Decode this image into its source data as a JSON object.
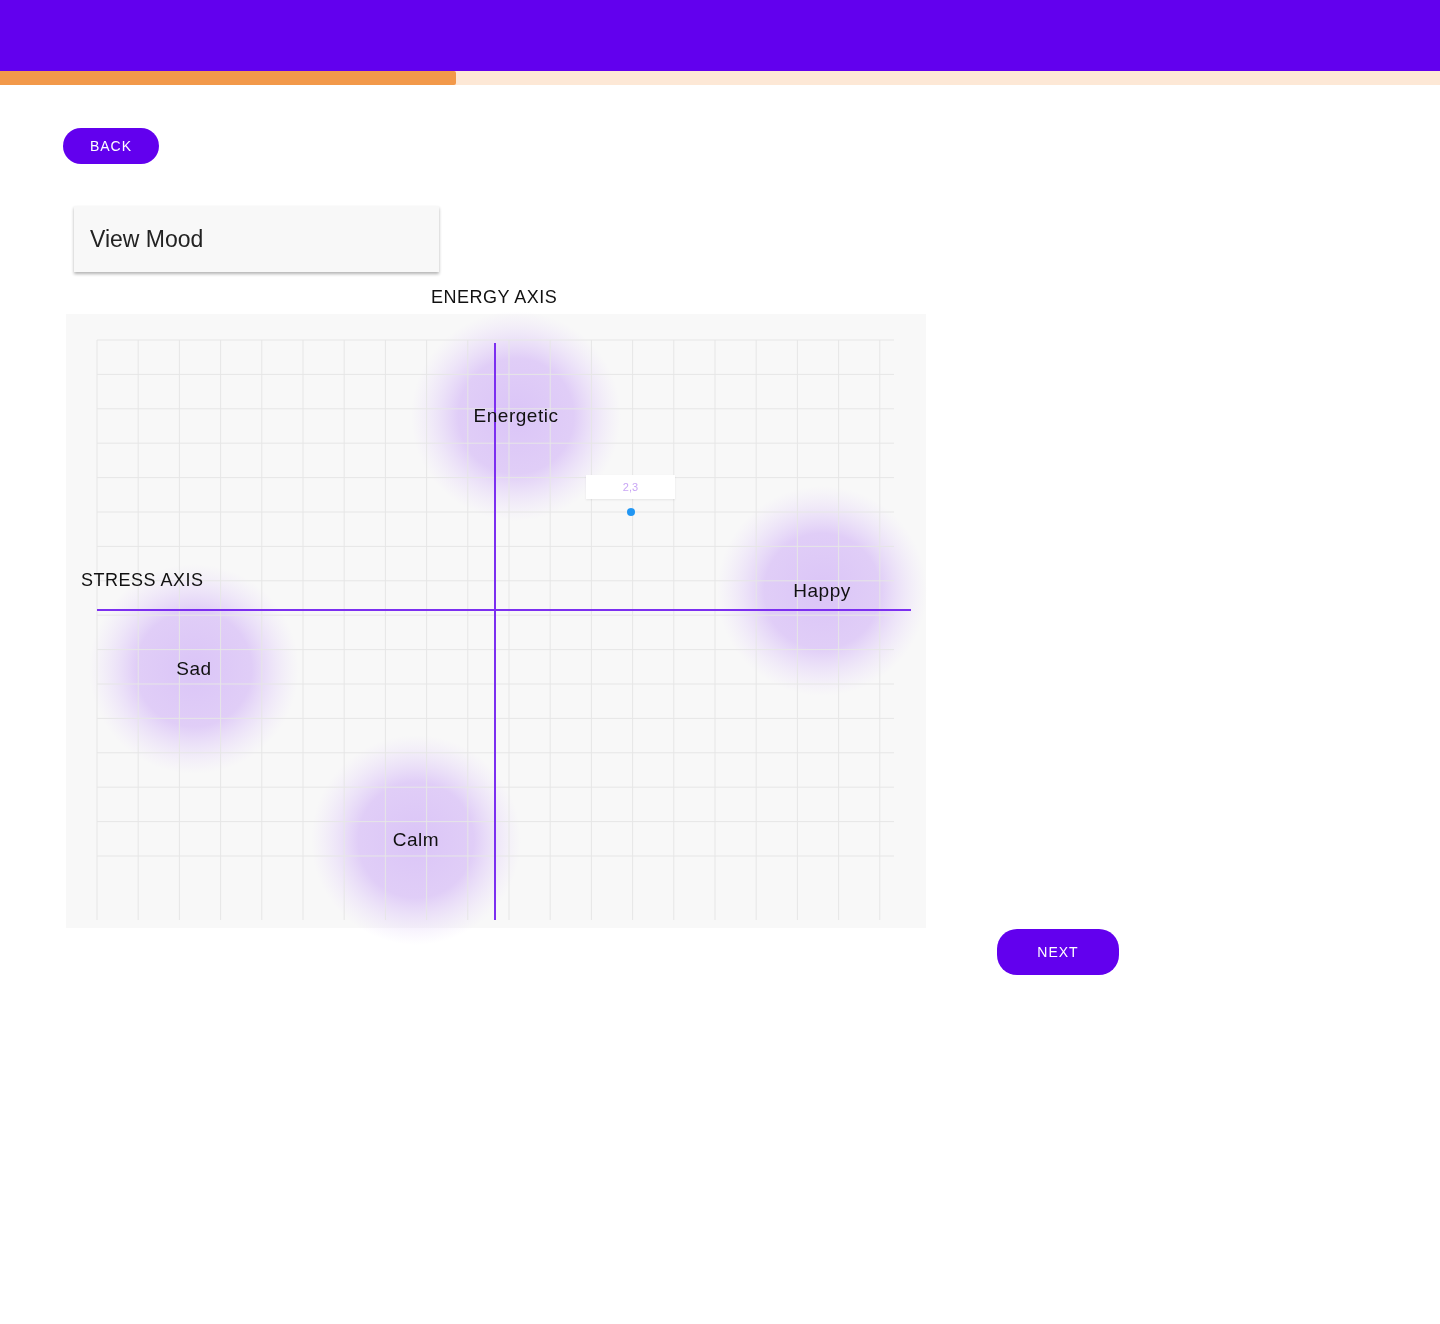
{
  "progress": {
    "level": 0.317
  },
  "back_button": "BACK",
  "title": "View Mood",
  "energy_axis": "ENERGY AXIS",
  "stress_axis": "STRESS AXIS",
  "moods": [
    {
      "label": "Energetic"
    },
    {
      "label": "Happy"
    },
    {
      "label": "Sad"
    },
    {
      "label": "Calm"
    }
  ],
  "point": {
    "tooltip": "2,3"
  },
  "next_button": "NEXT"
}
